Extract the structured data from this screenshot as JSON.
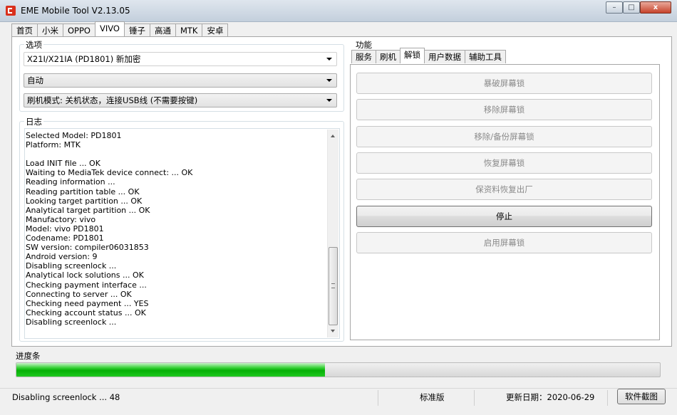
{
  "window": {
    "title": "EME Mobile Tool V2.13.05",
    "controls": {
      "minimize": "–",
      "maximize": "□",
      "close": "x"
    }
  },
  "top_tabs": [
    "首页",
    "小米",
    "OPPO",
    "VIVO",
    "锤子",
    "高通",
    "MTK",
    "安卓"
  ],
  "active_top_tab": "VIVO",
  "options": {
    "label": "选项",
    "model_select": "X21I/X21IA (PD1801) 新加密",
    "mode_select": "自动",
    "flash_mode_select": "刷机模式: 关机状态，连接USB线 (不需要按键)"
  },
  "log": {
    "label": "日志",
    "lines": [
      "Selected Model: PD1801",
      "Platform: MTK",
      "",
      "Load INIT file ... OK",
      "Waiting to MediaTek device connect: ... OK",
      "Reading information ...",
      "Reading partition table ... OK",
      "Looking target partition ... OK",
      "Analytical target partition ... OK",
      "Manufactory: vivo",
      "Model: vivo PD1801",
      "Codename: PD1801",
      "SW version: compiler06031853",
      "Android version: 9",
      "Disabling screenlock ...",
      "Analytical lock solutions ... OK",
      "Checking payment interface ...",
      "Connecting to server ... OK",
      "Checking need payment ... YES",
      "Checking account status ... OK",
      "Disabling screenlock ..."
    ]
  },
  "function": {
    "label": "功能",
    "tabs": [
      "服务",
      "刷机",
      "解锁",
      "用户数据",
      "辅助工具"
    ],
    "active_tab": "解锁",
    "buttons": [
      {
        "label": "暴破屏幕锁",
        "enabled": false
      },
      {
        "label": "移除屏幕锁",
        "enabled": false
      },
      {
        "label": "移除/备份屏幕锁",
        "enabled": false
      },
      {
        "label": "恢复屏幕锁",
        "enabled": false
      },
      {
        "label": "保资料恢复出厂",
        "enabled": false
      },
      {
        "label": "停止",
        "enabled": true
      },
      {
        "label": "启用屏幕锁",
        "enabled": false
      }
    ]
  },
  "progress": {
    "label": "进度条",
    "percent": 48
  },
  "status": {
    "message": "Disabling screenlock ... 48",
    "edition": "标准版",
    "update_date": "更新日期：2020-06-29",
    "screenshot_button": "软件截图"
  },
  "colors": {
    "progress_green": "#06b006",
    "close_button": "#c7432b",
    "app_icon": "#d9301c"
  }
}
